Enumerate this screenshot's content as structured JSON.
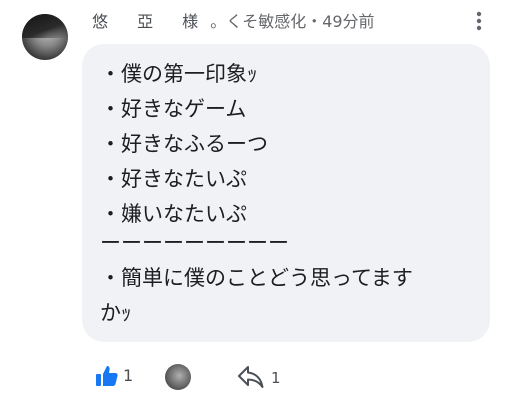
{
  "comment": {
    "author": "悠 亞 様",
    "meta": " 。くそ敏感化・49分前",
    "lines": [
      "・僕の第一印象ｯ",
      "・好きなゲーム",
      "・好きなふるーつ",
      "・好きなたいぷ",
      "・嫌いなたいぷ",
      "ーーーーーーーーー",
      "・簡単に僕のことどう思ってます",
      "かｯ"
    ]
  },
  "actions": {
    "like_count": "1",
    "reply_count": "1",
    "like_icon": "thumbs-up-icon",
    "reply_icon": "reply-arrow-icon",
    "accent_color": "#1877f2"
  },
  "menu_icon": "more-vertical-icon"
}
